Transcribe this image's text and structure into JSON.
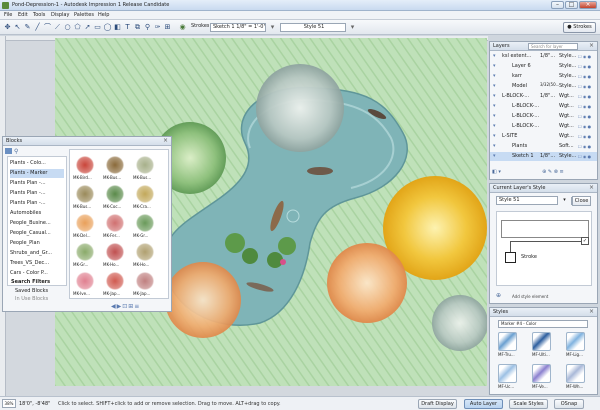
{
  "window": {
    "title": "Pond-Depression-1 - Autodesk Impression 1 Release Candidate"
  },
  "menu": [
    "File",
    "Edit",
    "Tools",
    "Display",
    "Palettes",
    "Help"
  ],
  "toolbar": {
    "layer_value": "Sketch 1",
    "scale_value": "1/8\" = 1'-0\"",
    "style_value": "Style 51",
    "strokes_label": "Strokes",
    "layer_prefix": "Strokes"
  },
  "blocks_panel": {
    "title": "Blocks",
    "items": [
      "Plants - Colo...",
      "Plants - Marker",
      "Plants Plan -...",
      "Plants Plan -...",
      "Plants Plan -...",
      "Automobiles",
      "People_Busine...",
      "People_Casual...",
      "People_Plan",
      "Shrubs_and_Gr...",
      "Trees_VS_Dec...",
      "Cars - Color P..."
    ],
    "selected_index": 1,
    "search_filters_label": "Search Filters",
    "saved_blocks_label": "Saved Blocks",
    "in_use_label": "In Use Blocks",
    "thumb_labels": [
      "MK-Bird...",
      "MK-Bus...",
      "MK-Bus...",
      "MK-Bus...",
      "MK-Coc...",
      "MK-Cra...",
      "MK-Del...",
      "MK-Fer...",
      "MK-Gr...",
      "MK-Gr...",
      "MK-Ho...",
      "MK-Ho...",
      "MK-Ive...",
      "MK-Jap...",
      "MK-Jap..."
    ]
  },
  "layers_panel": {
    "title": "Layers",
    "search_placeholder": "Search for layer",
    "rows": [
      {
        "name": "ksl extent...",
        "scale": "1/8\"...",
        "style": "Style..."
      },
      {
        "name": "Layer 6",
        "scale": "",
        "style": "Style..."
      },
      {
        "name": "karr",
        "scale": "",
        "style": "Style..."
      },
      {
        "name": "Model",
        "scale": "",
        "style": "Style..."
      },
      {
        "name": "L-BLOCK-...",
        "scale": "1/8\"...",
        "style": "Wgt..."
      },
      {
        "name": "L-BLOCK-...",
        "scale": "",
        "style": "Wgt..."
      },
      {
        "name": "L-BLOCK-...",
        "scale": "",
        "style": "Wgt..."
      },
      {
        "name": "L-BLOCK-...",
        "scale": "",
        "style": "Wgt..."
      },
      {
        "name": "L-SITE",
        "scale": "",
        "style": "Wgt..."
      },
      {
        "name": "Plants",
        "scale": "",
        "style": "Soft..."
      },
      {
        "name": "Sketch 1",
        "scale": "1/8\"...",
        "style": "Style..."
      }
    ],
    "header_scale": "3/32(50...",
    "selected_index": 10
  },
  "style_panel": {
    "title": "Current Layer's Style",
    "style_value": "Style 51",
    "close_label": "Close",
    "stroke_label": "Stroke",
    "add_label": "Add style element"
  },
  "styles_panel": {
    "title": "Styles",
    "filter_value": "Marker #4 - Color",
    "swatch_labels": [
      "MF-Tru...",
      "MF-Ulti...",
      "MF-Lig...",
      "MF-Uc...",
      "MF-Ve...",
      "MF-Wh..."
    ],
    "colors": [
      "#6a9fd0",
      "#2c5d9e",
      "#7fb2df",
      "#9cc0e4",
      "#8a7fcf",
      "#a9b8d8"
    ]
  },
  "status": {
    "coords": "18'0\", -8'48\"",
    "zoom": "38%",
    "hint": "Click to select. SHIFT+click to add or remove selection. Drag to move. ALT+drag to copy.",
    "buttons": [
      "Draft Display",
      "Auto Layer",
      "Scale Styles",
      "OSnap"
    ],
    "active_index": 1
  },
  "colors": {
    "grass": "#bfe1b9",
    "water": "#7fb4b7",
    "accent": "#c7dbf3"
  }
}
